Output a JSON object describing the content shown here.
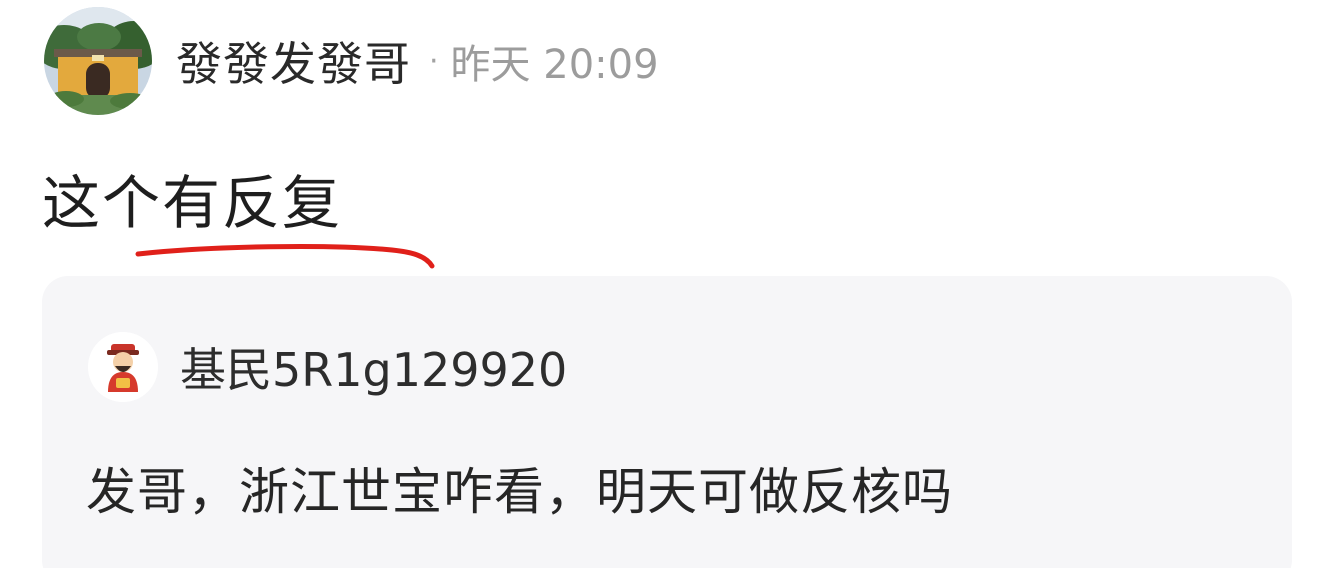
{
  "post": {
    "author": "發發发發哥",
    "separator": "·",
    "time": "昨天 20:09",
    "content": "这个有反复",
    "avatar_icon": "temple-photo-avatar"
  },
  "annotation": {
    "color": "#e0201a",
    "type": "handdrawn-underline"
  },
  "quoted": {
    "author": "基民5R1g129920",
    "content": "发哥，浙江世宝咋看，明天可做反核吗",
    "avatar_icon": "fortune-god-avatar"
  }
}
